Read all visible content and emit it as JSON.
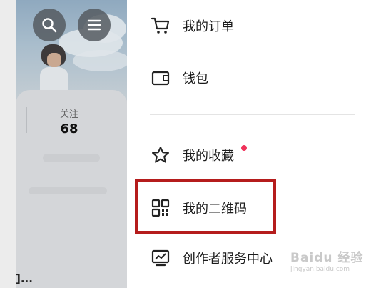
{
  "profile": {
    "follow_label": "关注",
    "follow_count": "68",
    "truncated_text": "]..."
  },
  "icons": {
    "search": "search-icon",
    "menu": "hamburger-menu-icon",
    "cart": "cart-icon",
    "wallet": "wallet-icon",
    "star": "star-icon",
    "qr": "qr-code-icon",
    "creator": "chart-monitor-icon"
  },
  "menu": {
    "orders_label": "我的订单",
    "wallet_label": "钱包",
    "favorites_label": "我的收藏",
    "qrcode_label": "我的二维码",
    "creator_label": "创作者服务中心"
  },
  "colors": {
    "highlight_border": "#b51c1c",
    "notification_dot": "#f0325a"
  },
  "watermark": {
    "main": "Baidu 经验",
    "sub": "jingyan.baidu.com"
  }
}
